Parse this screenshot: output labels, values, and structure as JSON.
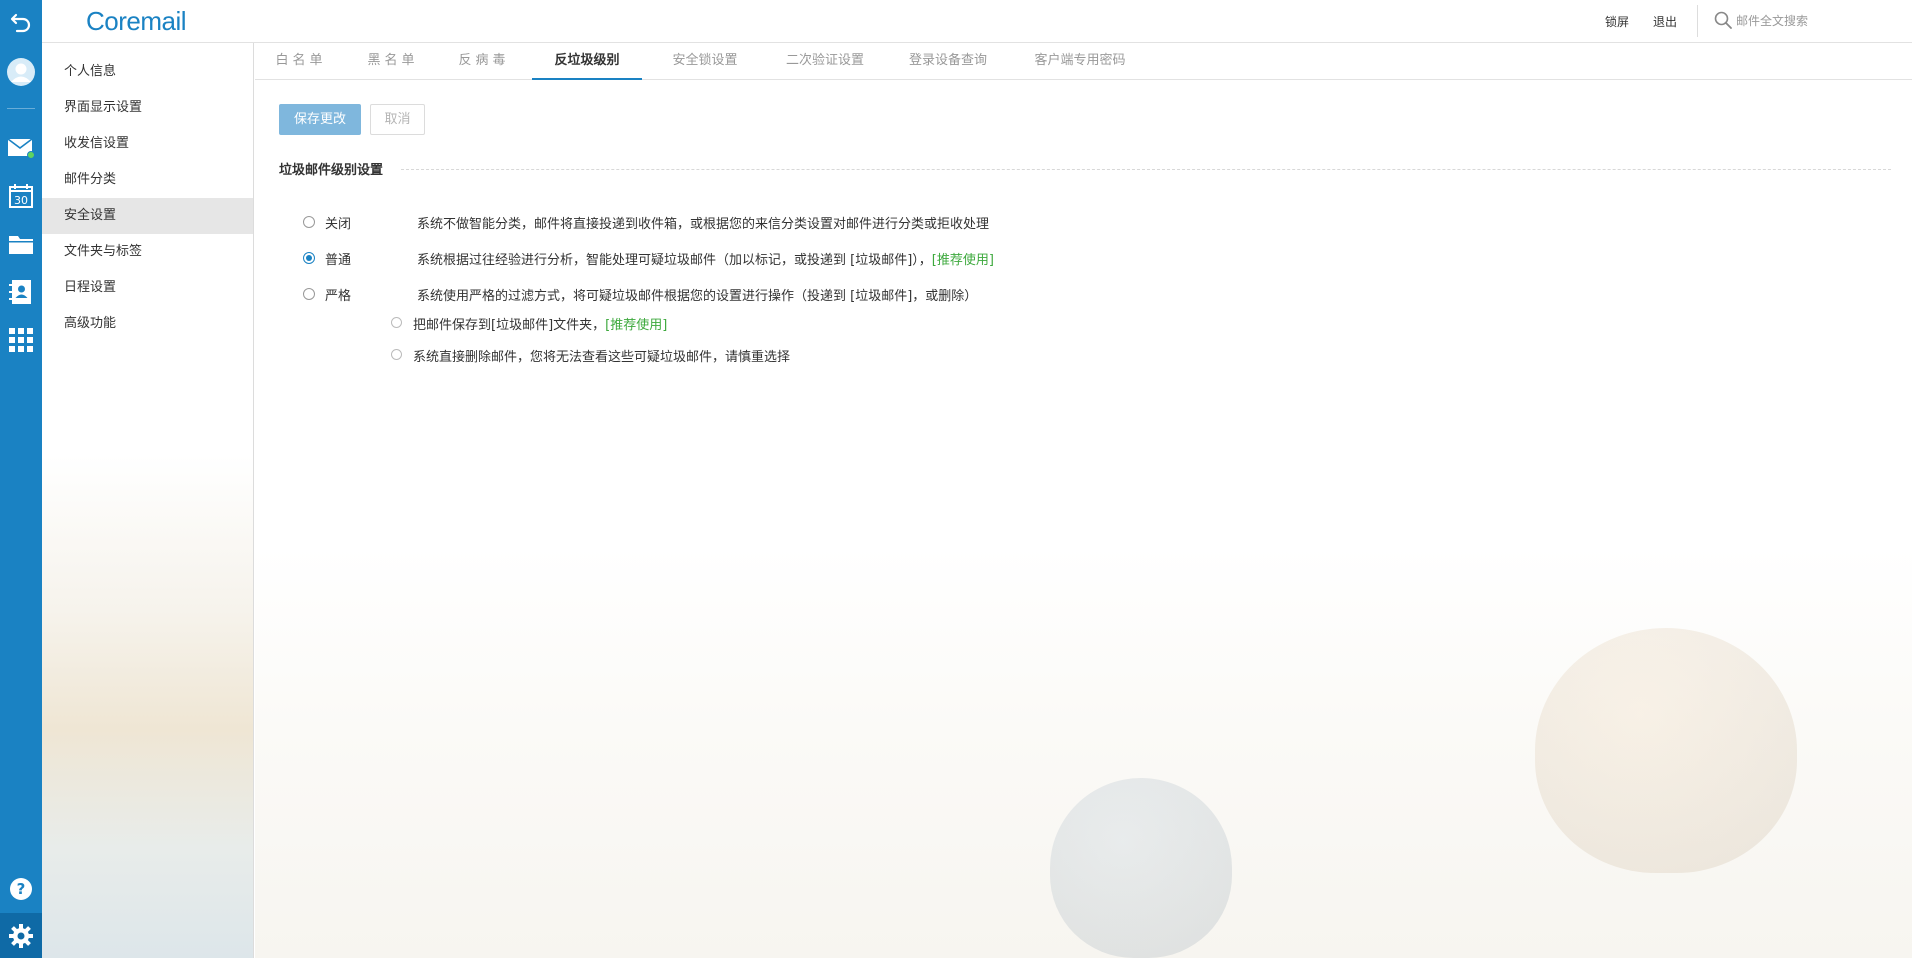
{
  "app": {
    "logo": "Coremail"
  },
  "header": {
    "lock_label": "锁屏",
    "logout_label": "退出",
    "search_placeholder": "邮件全文搜索"
  },
  "rail": {
    "icons": [
      "back-icon",
      "avatar-icon",
      "mail-icon",
      "calendar-icon",
      "folder-icon",
      "contacts-icon",
      "apps-grid-icon",
      "help-icon",
      "gear-icon"
    ],
    "calendar_day": "30",
    "colors": {
      "rail_bg": "#1a82c3",
      "mail_dot": "#5fd35f"
    }
  },
  "sidebar": {
    "items": [
      {
        "label": "个人信息"
      },
      {
        "label": "界面显示设置"
      },
      {
        "label": "收发信设置"
      },
      {
        "label": "邮件分类"
      },
      {
        "label": "安全设置",
        "active": true
      },
      {
        "label": "文件夹与标签"
      },
      {
        "label": "日程设置"
      },
      {
        "label": "高级功能"
      }
    ]
  },
  "tabs": [
    {
      "label": "白名单"
    },
    {
      "label": "黑名单"
    },
    {
      "label": "反病毒"
    },
    {
      "label": "反垃圾级别",
      "active": true
    },
    {
      "label": "安全锁设置"
    },
    {
      "label": "二次验证设置"
    },
    {
      "label": "登录设备查询"
    },
    {
      "label": "客户端专用密码"
    }
  ],
  "buttons": {
    "save": "保存更改",
    "cancel": "取消"
  },
  "section": {
    "title": "垃圾邮件级别设置"
  },
  "options": [
    {
      "label": "关闭",
      "desc": "系统不做智能分类，邮件将直接投递到收件箱，或根据您的来信分类设置对邮件进行分类或拒收处理",
      "recommend": "",
      "selected": false
    },
    {
      "label": "普通",
      "desc": "系统根据过往经验进行分析，智能处理可疑垃圾邮件（加以标记，或投递到 [垃圾邮件]），",
      "recommend": "[推荐使用]",
      "selected": true
    },
    {
      "label": "严格",
      "desc": "系统使用严格的过滤方式，将可疑垃圾邮件根据您的设置进行操作（投递到 [垃圾邮件]，或删除）",
      "recommend": "",
      "selected": false
    }
  ],
  "sub_options": [
    {
      "desc": "把邮件保存到[垃圾邮件]文件夹，",
      "recommend": "[推荐使用]",
      "selected": false
    },
    {
      "desc": "系统直接删除邮件，您将无法查看这些可疑垃圾邮件，请慎重选择",
      "recommend": "",
      "selected": false
    }
  ],
  "colors": {
    "accent": "#1a82c3",
    "recommend_green": "#3da93d",
    "save_button": "#7fb7dd"
  }
}
